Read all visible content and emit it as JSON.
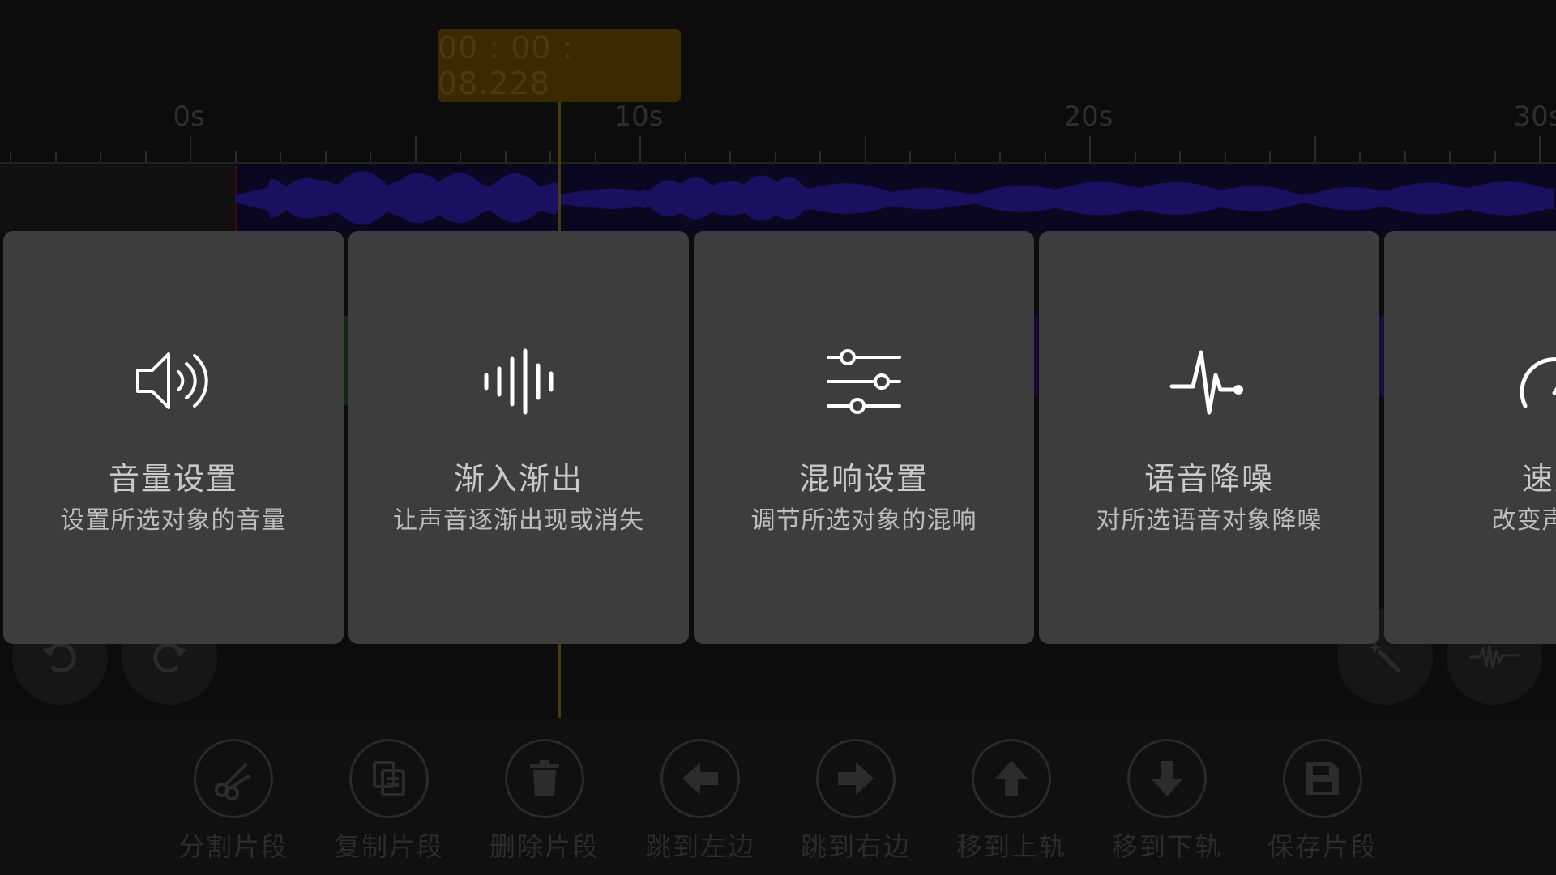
{
  "timeline": {
    "current_time": "00 : 00 : 08.228",
    "ruler_labels": [
      "0s",
      "10s",
      "20s",
      "30s"
    ]
  },
  "cards": [
    {
      "icon": "speaker-icon",
      "title": "音量设置",
      "desc": "设置所选对象的音量"
    },
    {
      "icon": "audio-bars-icon",
      "title": "渐入渐出",
      "desc": "让声音逐渐出现或消失"
    },
    {
      "icon": "sliders-icon",
      "title": "混响设置",
      "desc": "调节所选对象的混响"
    },
    {
      "icon": "pulse-icon",
      "title": "语音降噪",
      "desc": "对所选语音对象降噪"
    },
    {
      "icon": "speedometer-icon",
      "title": "速度",
      "desc": "改变声音播"
    }
  ],
  "toolbar": {
    "items": [
      {
        "icon": "scissors-icon",
        "label": "分割片段"
      },
      {
        "icon": "copy-icon",
        "label": "复制片段"
      },
      {
        "icon": "trash-icon",
        "label": "删除片段"
      },
      {
        "icon": "arrow-left-icon",
        "label": "跳到左边"
      },
      {
        "icon": "arrow-right-icon",
        "label": "跳到右边"
      },
      {
        "icon": "arrow-up-icon",
        "label": "移到上轨"
      },
      {
        "icon": "arrow-down-icon",
        "label": "移到下轨"
      },
      {
        "icon": "save-icon",
        "label": "保存片段"
      }
    ]
  },
  "colors": {
    "card_bg": "#3d3d3d",
    "waveform": "#1a1060",
    "badge": "#3b2a00"
  }
}
